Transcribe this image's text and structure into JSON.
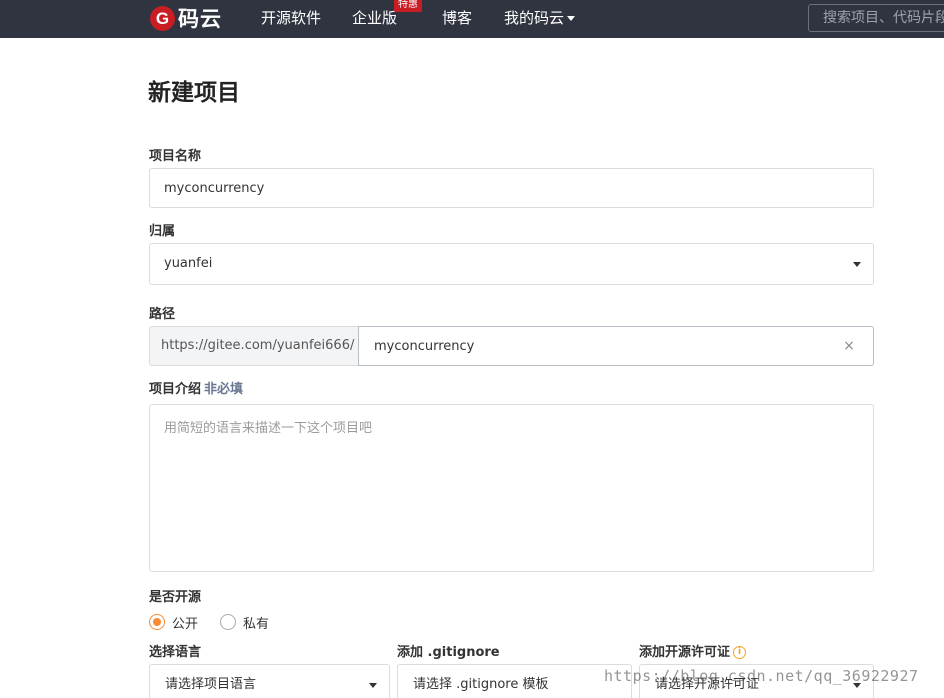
{
  "header": {
    "logo_mark": "G",
    "logo_text": "码云",
    "nav": [
      {
        "label": "开源软件"
      },
      {
        "label": "企业版"
      },
      {
        "label": "博客"
      },
      {
        "label": "我的码云"
      }
    ],
    "badge": "特惠",
    "search_placeholder": "搜索项目、代码片段"
  },
  "page": {
    "title": "新建项目"
  },
  "form": {
    "name_label": "项目名称",
    "name_value": "myconcurrency",
    "owner_label": "归属",
    "owner_value": "yuanfei",
    "path_label": "路径",
    "path_prefix": "https://gitee.com/yuanfei666/",
    "path_value": "myconcurrency",
    "path_clear": "×",
    "desc_label": "项目介绍",
    "desc_optional": "非必填",
    "desc_placeholder": "用简短的语言来描述一下这个项目吧",
    "open_label": "是否开源",
    "public_label": "公开",
    "private_label": "私有",
    "language_label": "选择语言",
    "language_placeholder": "请选择项目语言",
    "gitignore_label": "添加 .gitignore",
    "gitignore_placeholder": "请选择 .gitignore 模板",
    "license_label": "添加开源许可证",
    "license_placeholder": "请选择开源许可证",
    "info_icon": "i"
  },
  "watermark": "https://blog.csdn.net/qq_36922927",
  "colors": {
    "header_bg": "#2f3440",
    "brand_red": "#c71d23",
    "radio_accent": "#f78a35"
  }
}
